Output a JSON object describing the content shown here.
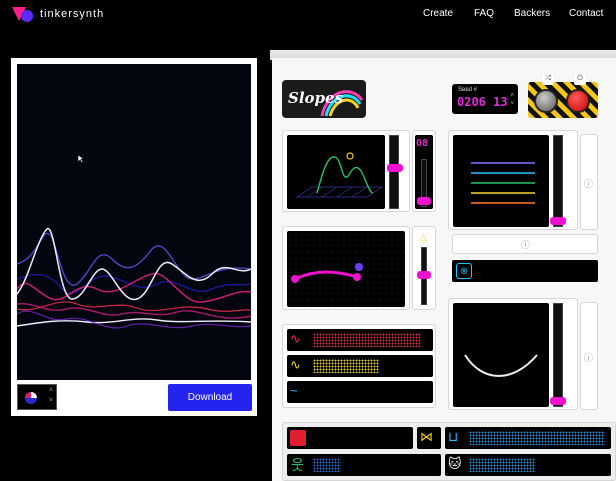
{
  "nav": {
    "brand": "tinkersynth",
    "links": [
      "Create",
      "FAQ",
      "Backers",
      "Contact"
    ]
  },
  "left": {
    "download_label": "Download"
  },
  "machine": {
    "title": "Slopes",
    "seed_label": "Seed #",
    "seed_value": "0206 13",
    "counter_value": "08",
    "colors": {
      "accent": "#ee11d0",
      "download_bg": "#2424ee",
      "seed_text": "#e02bd1"
    }
  },
  "icons": [
    "logo-icon",
    "cursor-icon",
    "swap-icon",
    "power-icon",
    "info-icon",
    "triangle-icon",
    "fingerprint-icon",
    "squiggle-icon",
    "zigzag-icon",
    "wave-icon",
    "cube-icon",
    "twist-icon",
    "cup-icon",
    "person-icon",
    "cat-icon"
  ]
}
